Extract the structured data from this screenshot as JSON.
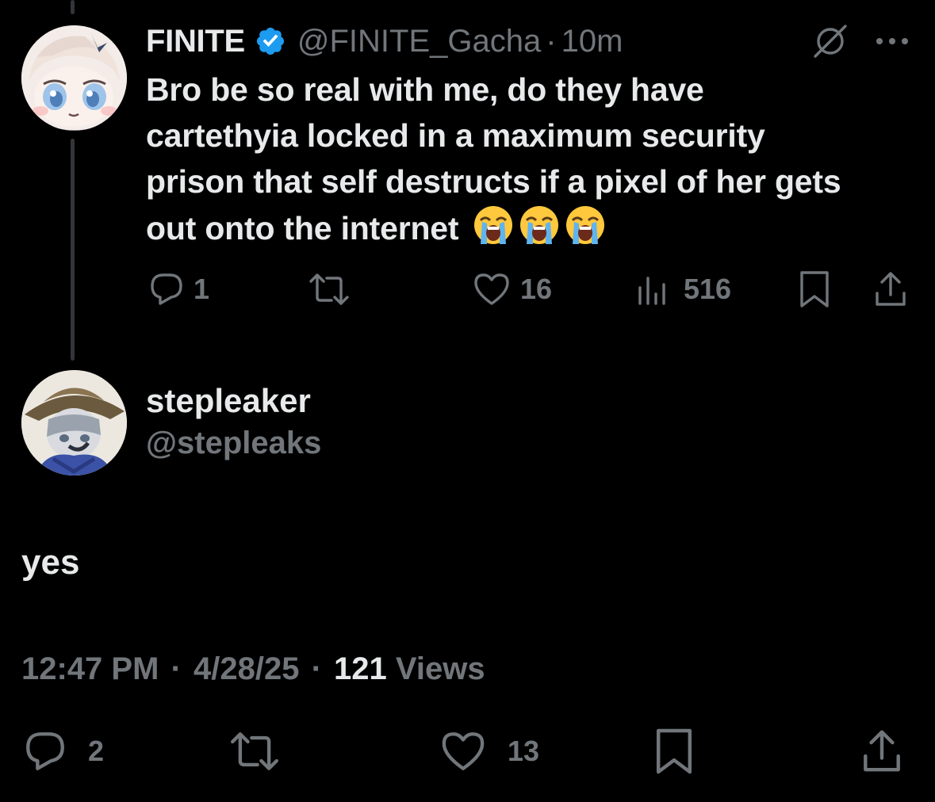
{
  "parent_tweet": {
    "display_name": "FINITE",
    "handle": "@FINITE_Gacha",
    "separator": "·",
    "time_ago": "10m",
    "text": "Bro be so real with me, do they have cartethyia locked in a maximum security prison that self destructs if a pixel of her gets out onto the internet",
    "emojis": [
      "loudly-crying-face",
      "loudly-crying-face",
      "loudly-crying-face"
    ],
    "actions": {
      "replies": "1",
      "reposts": "",
      "likes": "16",
      "views": "516"
    }
  },
  "main_tweet": {
    "display_name": "stepleaker",
    "handle": "@stepleaks",
    "text": "yes",
    "time": "12:47 PM",
    "date": "4/28/25",
    "separator": "·",
    "views_count": "121",
    "views_label": "Views",
    "actions": {
      "replies": "2",
      "reposts": "",
      "likes": "13"
    }
  },
  "colors": {
    "background": "#000000",
    "text_primary": "#e7e9ea",
    "text_muted": "#71767b",
    "verified": "#1d9bf0",
    "thread_line": "#333639"
  }
}
